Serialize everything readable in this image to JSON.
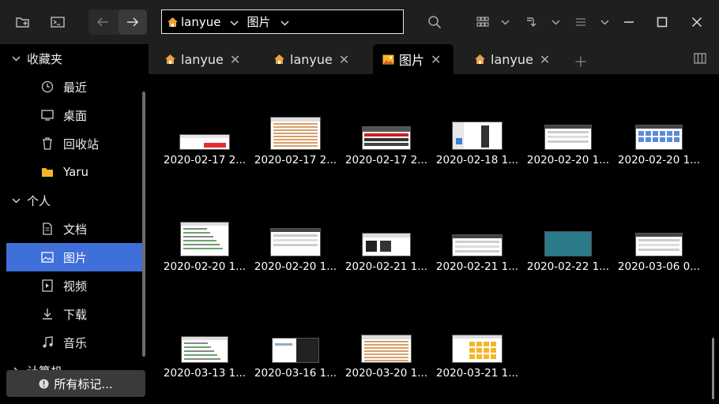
{
  "toolbar": {
    "path": [
      {
        "label": "lanyue",
        "icon": "home-icon"
      },
      {
        "label": "图片",
        "icon": ""
      }
    ]
  },
  "sidebar": {
    "favorites_header": "收藏夹",
    "favorites": [
      {
        "label": "最近",
        "icon": "clock-icon"
      },
      {
        "label": "桌面",
        "icon": "desktop-icon"
      },
      {
        "label": "回收站",
        "icon": "trash-icon"
      },
      {
        "label": "Yaru",
        "icon": "folder-icon"
      }
    ],
    "personal_header": "个人",
    "personal": [
      {
        "label": "文档",
        "icon": "document-icon"
      },
      {
        "label": "图片",
        "icon": "image-icon",
        "active": true
      },
      {
        "label": "视频",
        "icon": "video-icon"
      },
      {
        "label": "下载",
        "icon": "download-icon"
      },
      {
        "label": "音乐",
        "icon": "music-icon"
      }
    ],
    "partial_header": "计算机",
    "footer": "所有标记..."
  },
  "tabs": [
    {
      "label": "lanyue",
      "icon": "home-icon",
      "active": false
    },
    {
      "label": "lanyue",
      "icon": "home-icon",
      "active": false
    },
    {
      "label": "图片",
      "icon": "image-folder-icon",
      "active": true
    },
    {
      "label": "lanyue",
      "icon": "home-icon",
      "active": false
    }
  ],
  "files": [
    {
      "label": "2020-02-17 2..."
    },
    {
      "label": "2020-02-17 2..."
    },
    {
      "label": "2020-02-17 2..."
    },
    {
      "label": "2020-02-18 1..."
    },
    {
      "label": "2020-02-20 1..."
    },
    {
      "label": "2020-02-20 1..."
    },
    {
      "label": "2020-02-20 1..."
    },
    {
      "label": "2020-02-20 1..."
    },
    {
      "label": "2020-02-21 1..."
    },
    {
      "label": "2020-02-21 1..."
    },
    {
      "label": "2020-02-22 1..."
    },
    {
      "label": "2020-03-06 0..."
    },
    {
      "label": "2020-03-13 1..."
    },
    {
      "label": "2020-03-16 1..."
    },
    {
      "label": "2020-03-20 1..."
    },
    {
      "label": "2020-03-21 1..."
    }
  ],
  "colors": {
    "accent": "#3f6fd8",
    "toolbar_bg": "#1f1f1f",
    "content_bg": "#000000"
  }
}
